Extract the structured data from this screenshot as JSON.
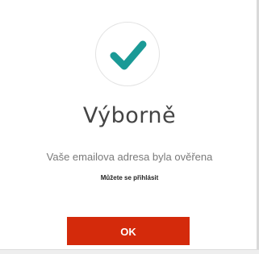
{
  "dialog": {
    "icon": "checkmark-icon",
    "title": "Výborně",
    "message": "Vaše emailova adresa byla ověřena",
    "hint": "Můžete se přihlásit",
    "ok_label": "OK"
  },
  "colors": {
    "accent": "#1a9a96",
    "button": "#d42a0b",
    "title_text": "#444444",
    "message_text": "#7a7a7a"
  }
}
